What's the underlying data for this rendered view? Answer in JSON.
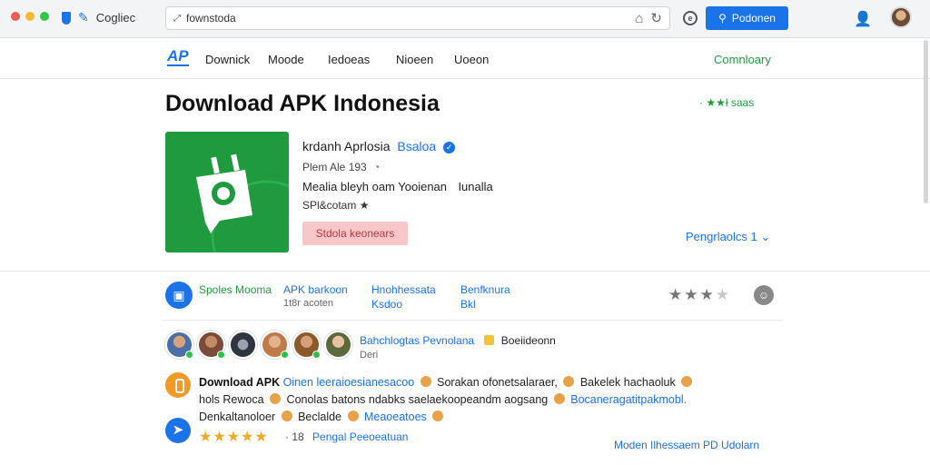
{
  "browser": {
    "brand_label": "Cogliec",
    "url": "fownstoda",
    "top_button_label": "Podonen",
    "colors": {
      "accent": "#1a73e8",
      "green": "#1e9e3a",
      "app_icon": "#1f9a3f"
    }
  },
  "nav": {
    "logo": "AP",
    "items": [
      "Downick",
      "Moode",
      "Iedoeas",
      "Nioeen",
      "Uoeon"
    ],
    "cta": "Comnloary"
  },
  "page": {
    "title": "Download APK Indonesia",
    "rating_label": "· ★★ł saas"
  },
  "app": {
    "name": "krdanh Aprlosia",
    "developer": "Bsaloa",
    "meta": "Plem Ale 193",
    "description": "Mealia bleyh oam Yooienan    Iunalla",
    "category": "SPl&cotam ★",
    "download_label": "Stdola keonears",
    "lang_link": "Pengrlaolcs 1 ⌄"
  },
  "stats": [
    {
      "label": "Spoles Mooma",
      "color": "#1e9e3a"
    },
    {
      "label": "APK barkoon",
      "sub": "1t8r acoten",
      "color": "#1a73e8"
    },
    {
      "label": "Hnohhessata",
      "sub": "Ksdoo",
      "color": "#1a73e8"
    },
    {
      "label": "Benfknura",
      "sub": "Bkl",
      "color": "#1a73e8"
    }
  ],
  "rating_widget": {
    "stars_filled": 3,
    "stars_total": 4
  },
  "community": {
    "title": "Bahchlogtas Pevnolana",
    "tag": "Boeiideonn",
    "subtitle": "Deri",
    "avatar_colors": [
      "#4d6fa8",
      "#7a4a3a",
      "#2e3440",
      "#c07a4a",
      "#8c5a2a",
      "#5a6a3a"
    ]
  },
  "reviews": {
    "line1_bold": "Download APK",
    "line1_blue": "Oinen leeraioesianesacoo",
    "line1_rest": "Sorakan ofonetsalaraer,",
    "line1_tail": "Bakelek hachaoluk",
    "line2_a": "hols Rewoca",
    "line2_b": "Conolas batons ndabks saelaekoopeandm aogsang",
    "line2_c": "Bocaneragatitpakmobl.",
    "line3_a": "Denkaltanoloer",
    "line3_b": "Beclalde",
    "line3_c": "Meaoeatoes",
    "stars": "★★★★★",
    "count": "· 18",
    "count_link": "Pengal Peeoeatuan",
    "more_link": "Moden Ilhessaem PD Udolarn"
  }
}
